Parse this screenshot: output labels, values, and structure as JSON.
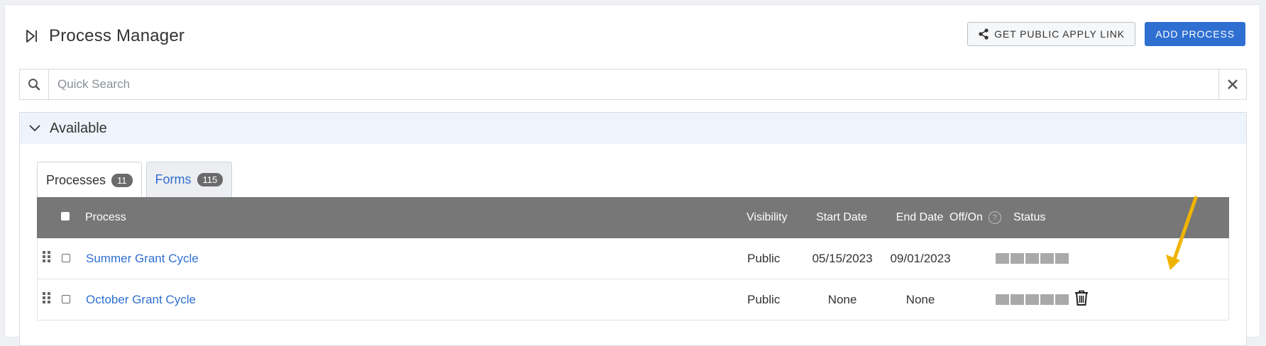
{
  "header": {
    "title": "Process Manager",
    "public_link_label": "GET PUBLIC APPLY LINK",
    "add_process_label": "ADD PROCESS"
  },
  "search": {
    "placeholder": "Quick Search",
    "value": ""
  },
  "panel": {
    "title": "Available"
  },
  "tabs": [
    {
      "label": "Processes",
      "count": "11",
      "active": true
    },
    {
      "label": "Forms",
      "count": "115",
      "active": false
    }
  ],
  "table": {
    "columns": {
      "process": "Process",
      "visibility": "Visibility",
      "start_date": "Start Date",
      "end_date": "End Date",
      "off_on": "Off/On",
      "status": "Status"
    },
    "rows": [
      {
        "name": "Summer Grant Cycle",
        "visibility": "Public",
        "start_date": "05/15/2023",
        "end_date": "09/01/2023",
        "toggle": "off"
      },
      {
        "name": "October Grant Cycle",
        "visibility": "Public",
        "start_date": "None",
        "end_date": "None",
        "toggle": "off"
      }
    ]
  },
  "colors": {
    "primary": "#2f6fd1",
    "table_header": "#777777",
    "annotation_arrow": "#f0b400"
  },
  "icons": [
    "collapse-sidebar-icon",
    "share-icon",
    "search-icon",
    "close-icon",
    "chevron-down-icon",
    "drag-handle-icon",
    "help-icon",
    "trash-icon"
  ]
}
